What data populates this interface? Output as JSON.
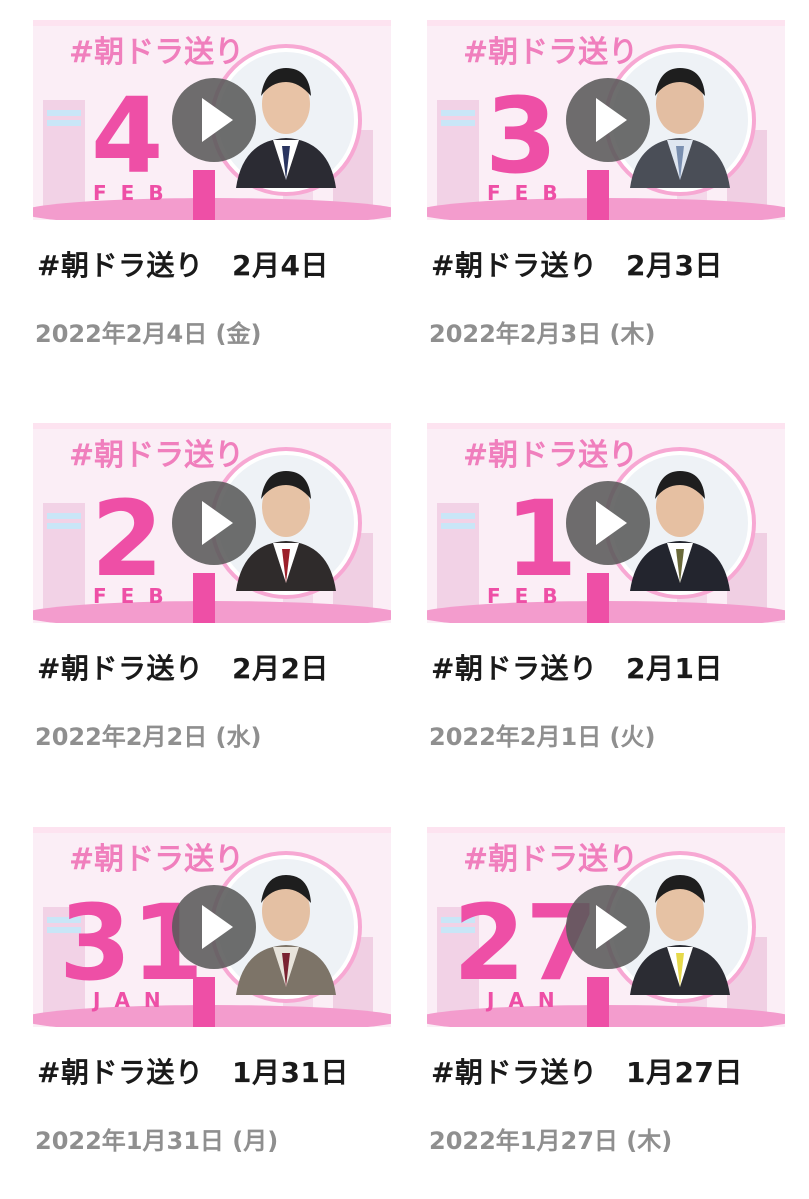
{
  "brand_text": "#朝ドラ送り",
  "colors": {
    "pink": "#ee4fa6",
    "pink_light": "#f7c3df",
    "stage_bg": "#fbeef6",
    "title": "#1a1a1a",
    "date": "#8f8f8f",
    "play_bg": "#5a5a5a"
  },
  "play_icon": "play-icon",
  "videos": [
    {
      "day": "4",
      "month": "FEB",
      "title": "#朝ドラ送り　2月4日",
      "date": "2022年2月4日 (金)",
      "tie": "#2a3560"
    },
    {
      "day": "3",
      "month": "FEB",
      "title": "#朝ドラ送り　2月3日",
      "date": "2022年2月3日 (木)",
      "tie": "#7a8fb0"
    },
    {
      "day": "2",
      "month": "FEB",
      "title": "#朝ドラ送り　2月2日",
      "date": "2022年2月2日 (水)",
      "tie": "#9c1f2a"
    },
    {
      "day": "1",
      "month": "FEB",
      "title": "#朝ドラ送り　2月1日",
      "date": "2022年2月1日 (火)",
      "tie": "#6b6a3a"
    },
    {
      "day": "31",
      "month": "JAN",
      "title": "#朝ドラ送り　1月31日",
      "date": "2022年1月31日 (月)",
      "tie": "#7a2231"
    },
    {
      "day": "27",
      "month": "JAN",
      "title": "#朝ドラ送り　1月27日",
      "date": "2022年1月27日 (木)",
      "tie": "#e6d94a"
    }
  ]
}
